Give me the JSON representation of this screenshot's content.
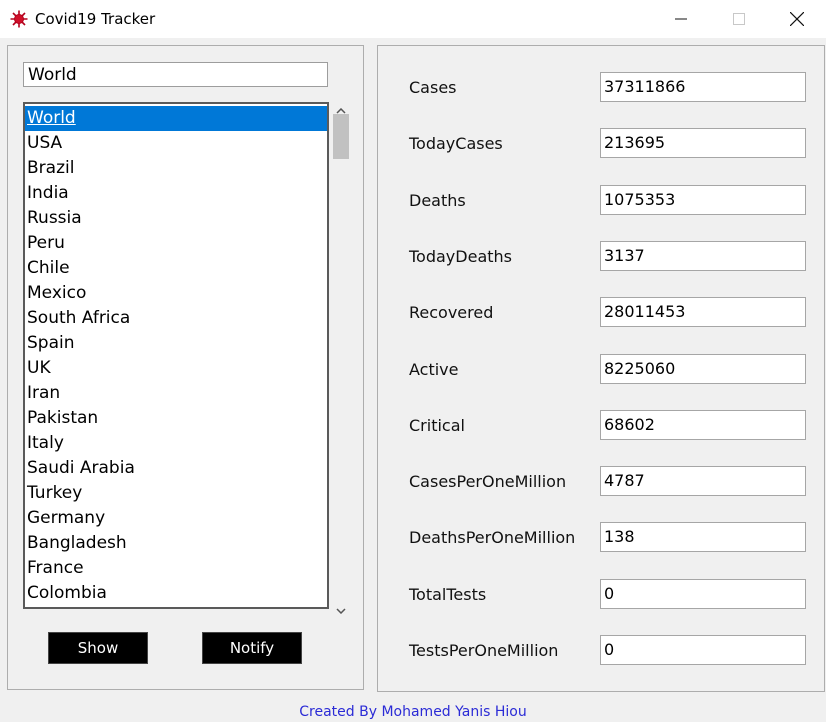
{
  "window": {
    "title": "Covid19 Tracker",
    "icon": "virus-icon",
    "controls": {
      "minimize": "minimize-icon",
      "maximize": "maximize-icon",
      "close": "close-icon"
    }
  },
  "search": {
    "value": "World"
  },
  "country_list": {
    "selected": "World",
    "items": [
      "World",
      "USA",
      "Brazil",
      "India",
      "Russia",
      "Peru",
      "Chile",
      "Mexico",
      "South Africa",
      "Spain",
      "UK",
      "Iran",
      "Pakistan",
      "Italy",
      "Saudi Arabia",
      "Turkey",
      "Germany",
      "Bangladesh",
      "France",
      "Colombia"
    ]
  },
  "buttons": {
    "show": "Show",
    "notify": "Notify"
  },
  "stats": [
    {
      "label": "Cases",
      "value": "37311866"
    },
    {
      "label": "TodayCases",
      "value": "213695"
    },
    {
      "label": "Deaths",
      "value": "1075353"
    },
    {
      "label": "TodayDeaths",
      "value": "3137"
    },
    {
      "label": "Recovered",
      "value": "28011453"
    },
    {
      "label": "Active",
      "value": "8225060"
    },
    {
      "label": "Critical",
      "value": "68602"
    },
    {
      "label": "CasesPerOneMillion",
      "value": "4787"
    },
    {
      "label": "DeathsPerOneMillion",
      "value": "138"
    },
    {
      "label": "TotalTests",
      "value": "0"
    },
    {
      "label": "TestsPerOneMillion",
      "value": "0"
    }
  ],
  "footer": {
    "credit": "Created By Mohamed Yanis Hiou"
  },
  "colors": {
    "selection": "#0078d7",
    "footer_text": "#2b2bd6",
    "button_bg": "#000000"
  }
}
